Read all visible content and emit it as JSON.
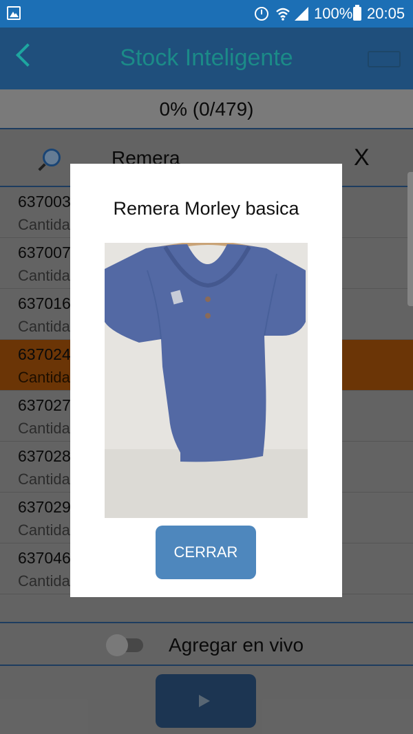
{
  "status_bar": {
    "battery_percent": "100%",
    "time": "20:05"
  },
  "app_bar": {
    "title": "Stock Inteligente"
  },
  "progress": {
    "text": "0% (0/479)"
  },
  "search": {
    "value": "Remera",
    "clear_label": "X"
  },
  "list": {
    "items": [
      {
        "code": "637003",
        "qty_label": "Cantida"
      },
      {
        "code": "637007",
        "qty_label": "Cantida"
      },
      {
        "code": "637016",
        "qty_label": "Cantida"
      },
      {
        "code": "637024",
        "qty_label": "Cantida"
      },
      {
        "code": "637027",
        "qty_label": "Cantida"
      },
      {
        "code": "637028",
        "qty_label": "Cantida"
      },
      {
        "code": "637029",
        "qty_label": "Cantida"
      },
      {
        "code": "637046",
        "qty_label": "Cantida"
      }
    ],
    "selected_index": 3
  },
  "live": {
    "label": "Agregar en vivo",
    "enabled": false
  },
  "dialog": {
    "title": "Remera Morley basica",
    "close_label": "CERRAR"
  },
  "colors": {
    "status_bar": "#1c6fb5",
    "app_bar": "#1f4f7c",
    "title_accent": "#1b8b88",
    "selected_row": "#a8530a",
    "dialog_button": "#4e87bd",
    "shirt": "#5369a4"
  },
  "icons": [
    "gallery-icon",
    "alarm-icon",
    "wifi-icon",
    "signal-icon",
    "battery-icon",
    "back-icon",
    "battery-outline-icon",
    "search-icon",
    "play-icon"
  ]
}
